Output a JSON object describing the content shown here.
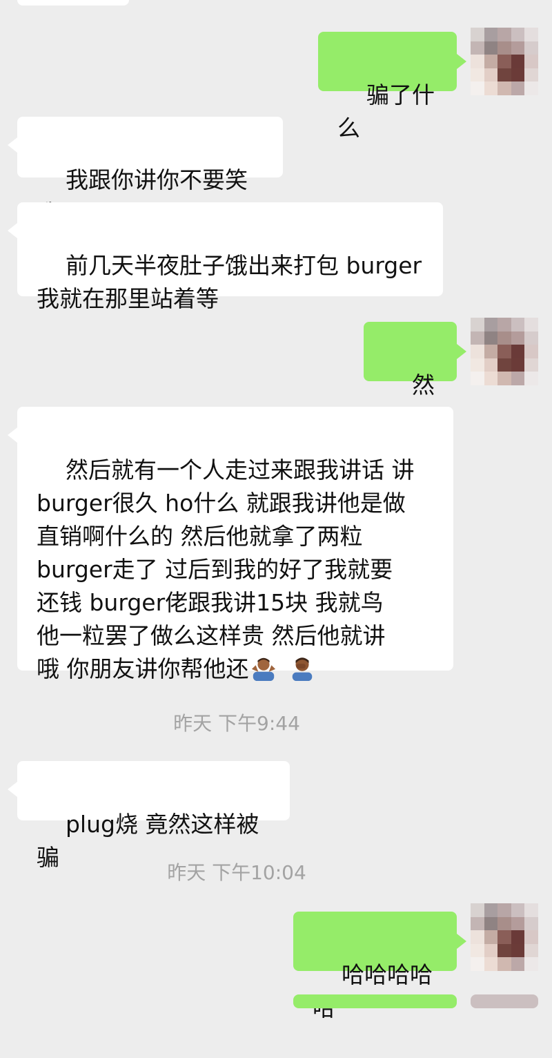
{
  "messages": {
    "m1": {
      "text": "骗了什么"
    },
    "m2": {
      "text": "我跟你讲你不要笑我"
    },
    "m3": {
      "text": "前几天半夜肚子饿出来打包 burger\n我就在那里站着等"
    },
    "m4": {
      "text": "然后"
    },
    "m5": {
      "text": "然后就有一个人走过来跟我讲话 讲\nburger很久 ho什么 就跟我讲他是做\n直销啊什么的 然后他就拿了两粒\nburger走了 过后到我的好了我就要\n还钱 burger佬跟我讲15块 我就鸟\n他一粒罢了做么这样贵 然后他就讲\n哦 你朋友讲你帮他还"
    },
    "m6": {
      "text": "plug烧 竟然这样被骗"
    },
    "m7": {
      "text": "哈哈哈哈哈"
    }
  },
  "timestamps": {
    "t1": "昨天 下午9:44",
    "t2": "昨天 下午10:04"
  },
  "emojis": {
    "e1": "person-shrugging-icon",
    "e2": "person-facepalming-icon"
  },
  "colors": {
    "background": "#ededed",
    "incoming_bubble": "#ffffff",
    "outgoing_bubble": "#95ec69",
    "timestamp_text": "#a3a3a3"
  }
}
